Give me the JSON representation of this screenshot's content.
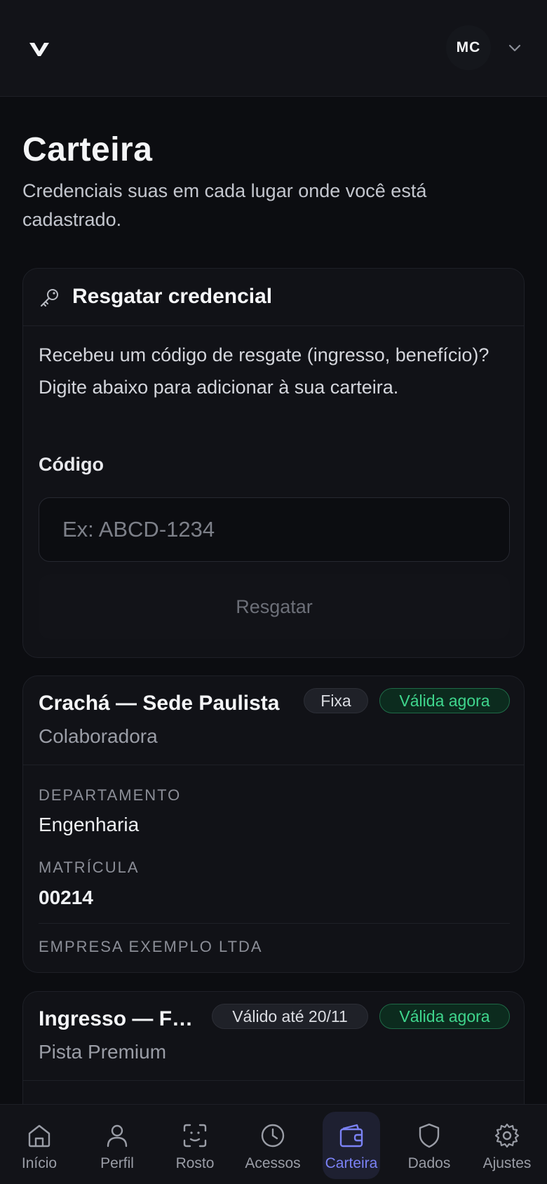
{
  "header": {
    "avatar_initials": "MC",
    "logo_icon": "v-logo-icon",
    "menu_icon": "chevron-down-icon"
  },
  "page": {
    "title": "Carteira",
    "subtitle": "Credenciais suas em cada lugar onde você está cadastrado."
  },
  "redeem": {
    "title": "Resgatar credencial",
    "description": "Recebeu um código de resgate (ingresso, benefício)? Digite abaixo para adicionar à sua carteira.",
    "code_label": "Código",
    "code_placeholder": "Ex: ABCD-1234",
    "code_value": "",
    "button_label": "Resgatar"
  },
  "credentials": [
    {
      "title": "Crachá — Sede Paulista",
      "subtitle": "Colaboradora",
      "type_badge": "Fixa",
      "status_badge": "Válida agora",
      "fields": [
        {
          "label": "DEPARTAMENTO",
          "value": "Engenharia"
        },
        {
          "label": "MATRÍCULA",
          "value": "00214"
        }
      ],
      "issuer": "EMPRESA EXEMPLO LTDA"
    },
    {
      "title": "Ingresso — F…",
      "subtitle": "Pista Premium",
      "type_badge": "Válido até 20/11",
      "status_badge": "Válida agora"
    }
  ],
  "nav": [
    {
      "label": "Início",
      "icon": "home-icon"
    },
    {
      "label": "Perfil",
      "icon": "user-icon"
    },
    {
      "label": "Rosto",
      "icon": "face-scan-icon"
    },
    {
      "label": "Acessos",
      "icon": "clock-icon"
    },
    {
      "label": "Carteira",
      "icon": "wallet-icon",
      "active": true
    },
    {
      "label": "Dados",
      "icon": "shield-icon"
    },
    {
      "label": "Ajustes",
      "icon": "gear-icon"
    }
  ],
  "colors": {
    "accent": "#7b82f5",
    "success": "#3fd68d",
    "background": "#0c0d11"
  }
}
